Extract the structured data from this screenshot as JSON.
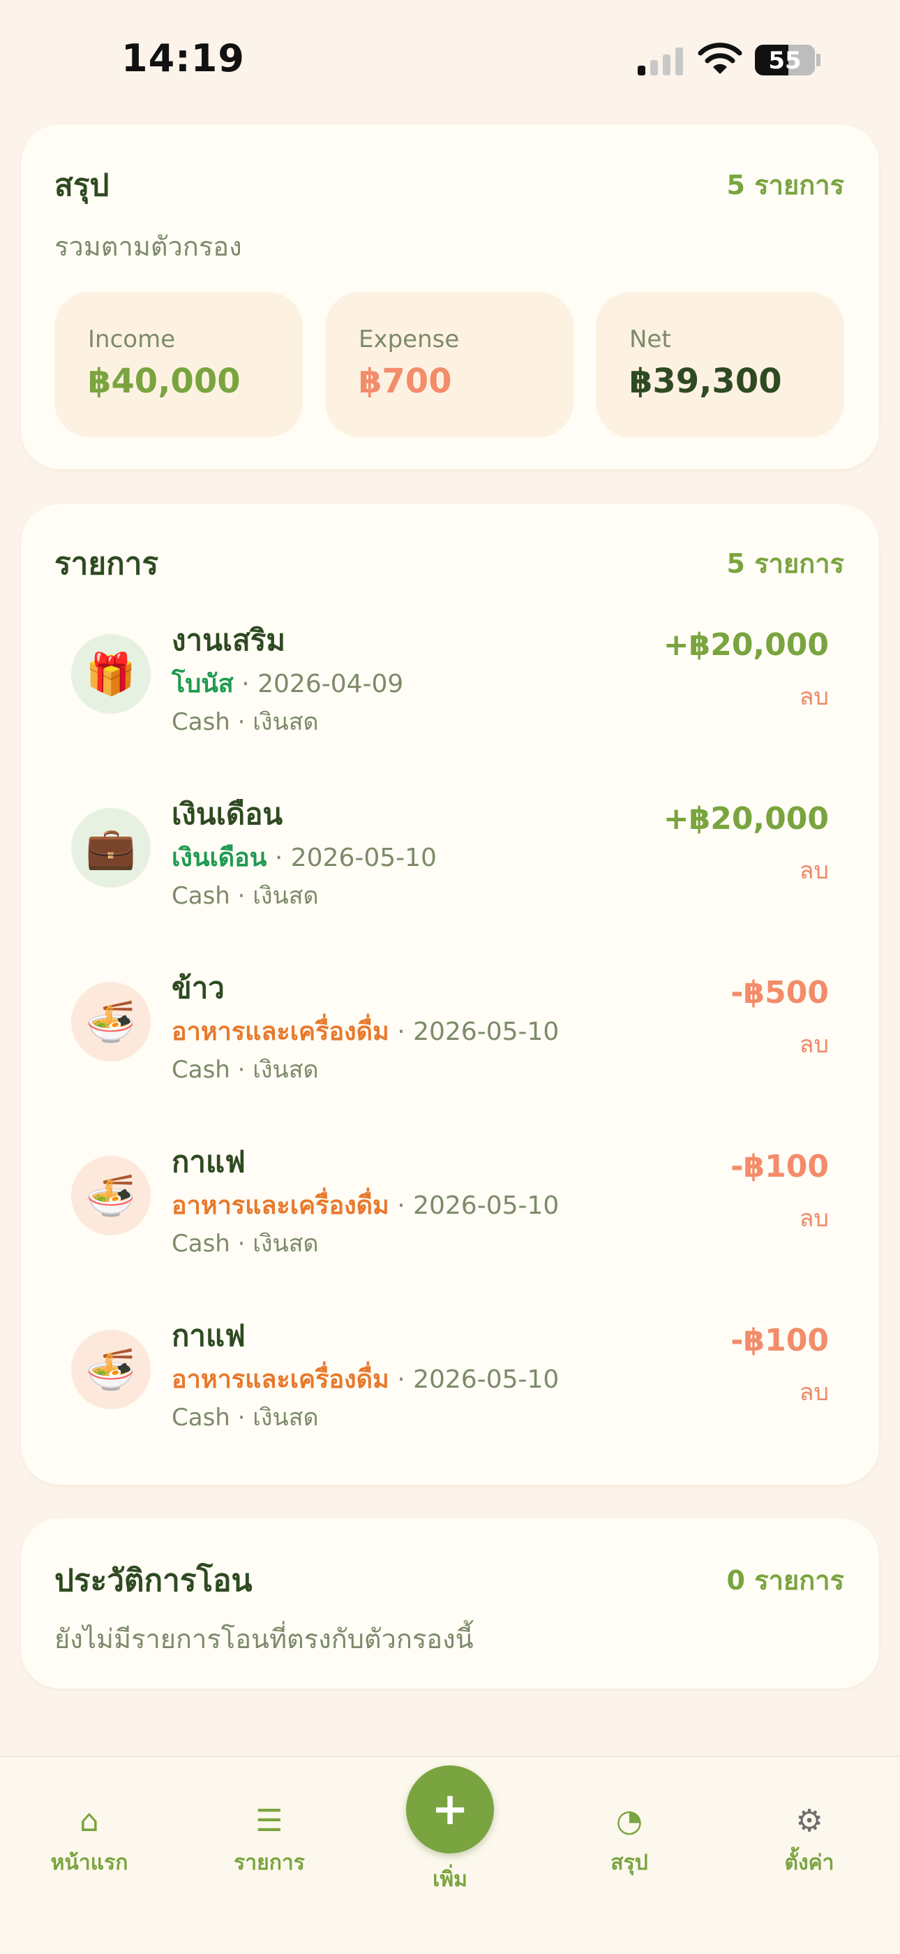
{
  "status_bar": {
    "time": "14:19",
    "battery": "55"
  },
  "summary": {
    "title": "สรุป",
    "count": "5 รายการ",
    "subtitle": "รวมตามตัวกรอง",
    "stats": [
      {
        "label": "Income",
        "value": "฿40,000",
        "color": "#7aa43f"
      },
      {
        "label": "Expense",
        "value": "฿700",
        "color": "#f28c6a"
      },
      {
        "label": "Net",
        "value": "฿39,300",
        "color": "#2f4a22"
      }
    ]
  },
  "transactions": {
    "title": "รายการ",
    "count": "5 รายการ",
    "delete_label": "ลบ",
    "items": [
      {
        "title": "งานเสริม",
        "category": "โบนัส",
        "date": "2026-04-09",
        "account": "Cash · เงินสด",
        "amount": "+฿20,000",
        "icon": "gift-icon",
        "glyph": "🎁",
        "type": "income"
      },
      {
        "title": "เงินเดือน",
        "category": "เงินเดือน",
        "date": "2026-05-10",
        "account": "Cash · เงินสด",
        "amount": "+฿20,000",
        "icon": "briefcase-icon",
        "glyph": "💼",
        "type": "income"
      },
      {
        "title": "ข้าว",
        "category": "อาหารและเครื่องดื่ม",
        "date": "2026-05-10",
        "account": "Cash · เงินสด",
        "amount": "-฿500",
        "icon": "noodle-bowl-icon",
        "glyph": "🍜",
        "type": "expense"
      },
      {
        "title": "กาแฟ",
        "category": "อาหารและเครื่องดื่ม",
        "date": "2026-05-10",
        "account": "Cash · เงินสด",
        "amount": "-฿100",
        "icon": "noodle-bowl-icon",
        "glyph": "🍜",
        "type": "expense"
      },
      {
        "title": "กาแฟ",
        "category": "อาหารและเครื่องดื่ม",
        "date": "2026-05-10",
        "account": "Cash · เงินสด",
        "amount": "-฿100",
        "icon": "noodle-bowl-icon",
        "glyph": "🍜",
        "type": "expense"
      }
    ]
  },
  "transfers": {
    "title": "ประวัติการโอน",
    "count": "0 รายการ",
    "empty_text": "ยังไม่มีรายการโอนที่ตรงกับตัวกรองนี้"
  },
  "tabbar": {
    "home": "หน้าแรก",
    "list": "รายการ",
    "add": "เพิ่ม",
    "summary": "สรุป",
    "settings": "ตั้งค่า"
  },
  "colors": {
    "accent": "#7aa43f",
    "expense": "#f28c6a",
    "income_category": "#1f9a50",
    "expense_category": "#e8782b"
  }
}
